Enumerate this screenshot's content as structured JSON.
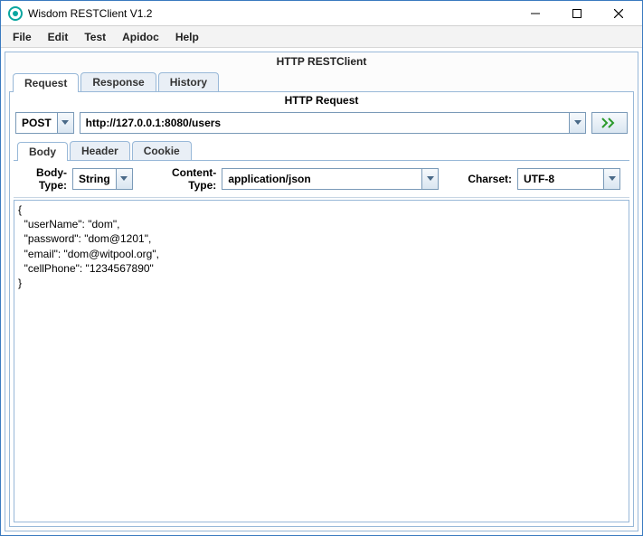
{
  "window": {
    "title": "Wisdom RESTClient V1.2"
  },
  "menu": {
    "items": [
      "File",
      "Edit",
      "Test",
      "Apidoc",
      "Help"
    ]
  },
  "outer": {
    "title": "HTTP RESTClient"
  },
  "mainTabs": {
    "items": [
      "Request",
      "Response",
      "History"
    ],
    "active": 0
  },
  "request": {
    "sectionTitle": "HTTP Request",
    "method": "POST",
    "url": "http://127.0.0.1:8080/users",
    "innerTabs": [
      "Body",
      "Header",
      "Cookie"
    ],
    "innerActive": 0,
    "bodyTypeLabel": "Body-Type:",
    "bodyType": "String",
    "contentTypeLabel": "Content-Type:",
    "contentType": "application/json",
    "charsetLabel": "Charset:",
    "charset": "UTF-8",
    "bodyText": "{\n  \"userName\": \"dom\",\n  \"password\": \"dom@1201\",\n  \"email\": \"dom@witpool.org\",\n  \"cellPhone\": \"1234567890\"\n}"
  }
}
